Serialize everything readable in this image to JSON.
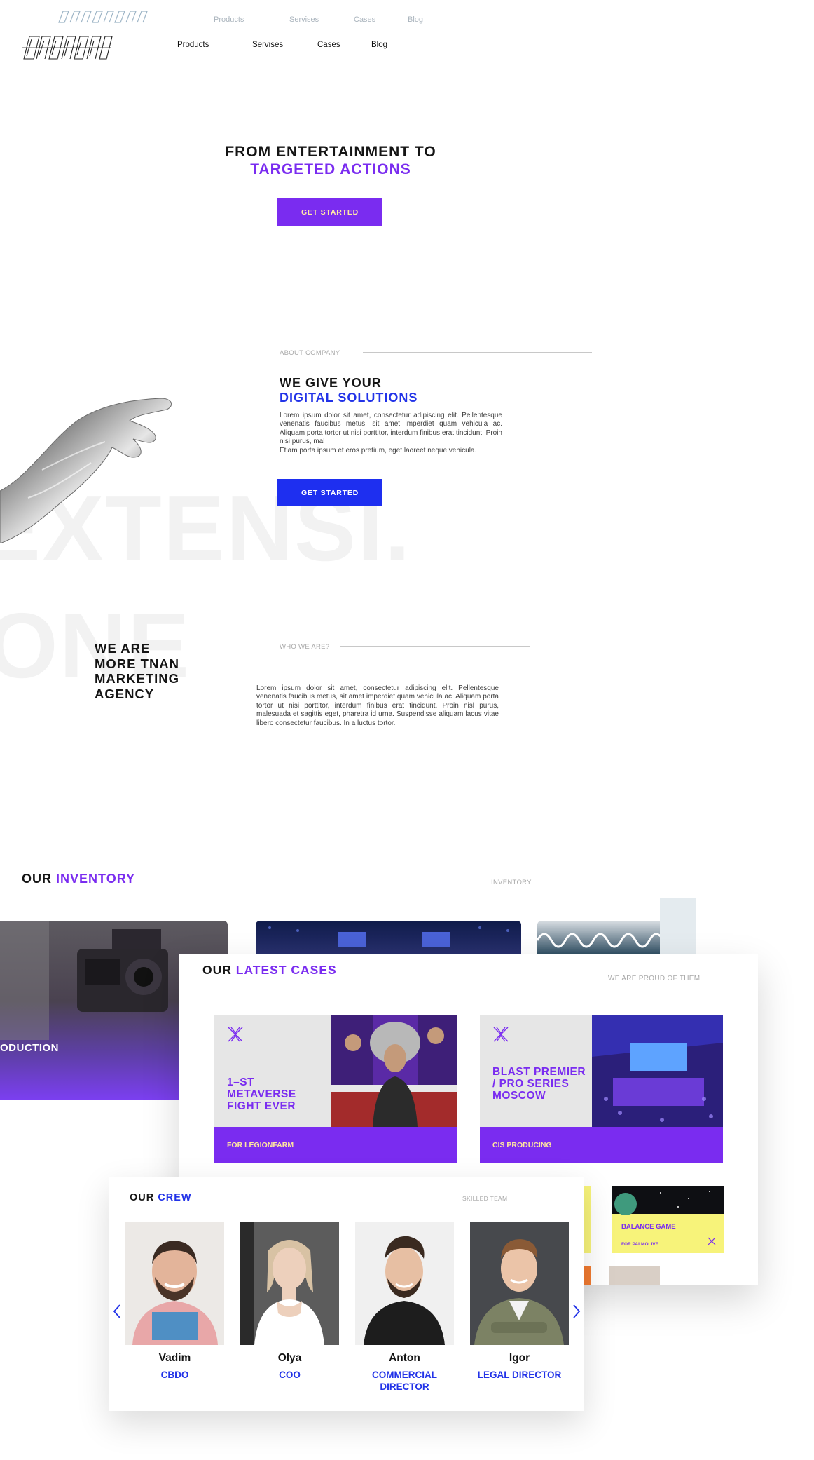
{
  "header": {
    "nav": [
      "Products",
      "Servises",
      "Cases",
      "Blog"
    ]
  },
  "hero": {
    "title_line1": "FROM ENTERTAINMENT TO",
    "title_line2": "TARGETED ACTIONS",
    "cta": "GET STARTED"
  },
  "about": {
    "eyebrow": "ABOUT COMPANY",
    "title_line1": "WE GIVE YOUR",
    "title_line2": "DIGITAL SOLUTIONS",
    "paragraph": "Lorem ipsum dolor sit amet, consectetur adipiscing elit. Pellentesque venenatis faucibus metus, sit amet imperdiet quam vehicula ac. Aliquam porta tortor ut nisi porttitor, interdum finibus erat tincidunt. Proin nisi purus, mal",
    "paragraph2": "Etiam porta ipsum et eros pretium, eget laoreet neque vehicula.",
    "cta": "GET STARTED",
    "big_text_line1": "EXTENSI.",
    "big_text_line2": "ONE"
  },
  "who": {
    "eyebrow": "WHO WE ARE?",
    "title": [
      "WE ARE",
      "MORE TNAN",
      "MARKETING",
      "AGENCY"
    ],
    "paragraph": "Lorem ipsum dolor sit amet, consectetur adipiscing elit. Pellentesque venenatis faucibus metus, sit amet imperdiet quam vehicula ac. Aliquam porta tortor ut nisi porttitor, interdum finibus erat tincidunt. Proin nisl purus, malesuada et sagittis eget, pharetra id urna. Suspendisse aliquam lacus vitae libero consectetur faucibus. In a luctus tortor."
  },
  "inventory": {
    "title_a": "OUR",
    "title_b": "INVENTORY",
    "eyebrow": "INVENTORY",
    "production_label": "ODUCTION"
  },
  "cases": {
    "title_a": "OUR",
    "title_b": "LATEST CASES",
    "eyebrow": "WE ARE PROUD OF THEM",
    "items": [
      {
        "title": "1–ST METAVERSE FIGHT EVER",
        "client": "FOR LEGIONFARM"
      },
      {
        "title": "BLAST PREMIER / PRO SERIES MOSCOW",
        "client": "CIS PRODUCING"
      }
    ],
    "mini": {
      "title": "BALANCE GAME",
      "client": "FOR PALMOLIVE"
    }
  },
  "crew": {
    "title_a": "OUR",
    "title_b": "CREW",
    "eyebrow": "SKILLED TEAM",
    "members": [
      {
        "name": "Vadim",
        "role": "CBDO"
      },
      {
        "name": "Olya",
        "role": "COO"
      },
      {
        "name": "Anton",
        "role": "COMMERCIAL DIRECTOR"
      },
      {
        "name": "Igor",
        "role": "LEGAL DIRECTOR"
      }
    ]
  },
  "colors": {
    "accent_purple": "#7a2cf0",
    "accent_blue": "#2233e8",
    "button_text_yellow": "#ffe9a8"
  }
}
